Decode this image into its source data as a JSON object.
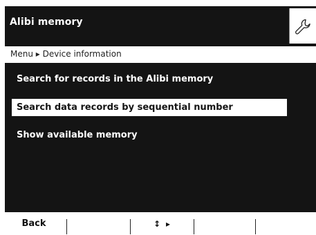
{
  "header": {
    "title": "Alibi memory",
    "settings_icon": "wrench-icon"
  },
  "breadcrumb": {
    "path": "Menu ▸ Device information"
  },
  "menu": {
    "items": [
      {
        "label": "Search for records in the Alibi memory",
        "selected": false
      },
      {
        "label": "Search data records by sequential number",
        "selected": true
      },
      {
        "label": "Show available memory",
        "selected": false
      }
    ]
  },
  "softkeys": {
    "back_label": "Back",
    "nav_updown_icon": "↕",
    "nav_right_icon": "▸"
  },
  "colors": {
    "panel": "#141414",
    "selection": "#ffffff",
    "text_on_dark": "#ffffff"
  }
}
